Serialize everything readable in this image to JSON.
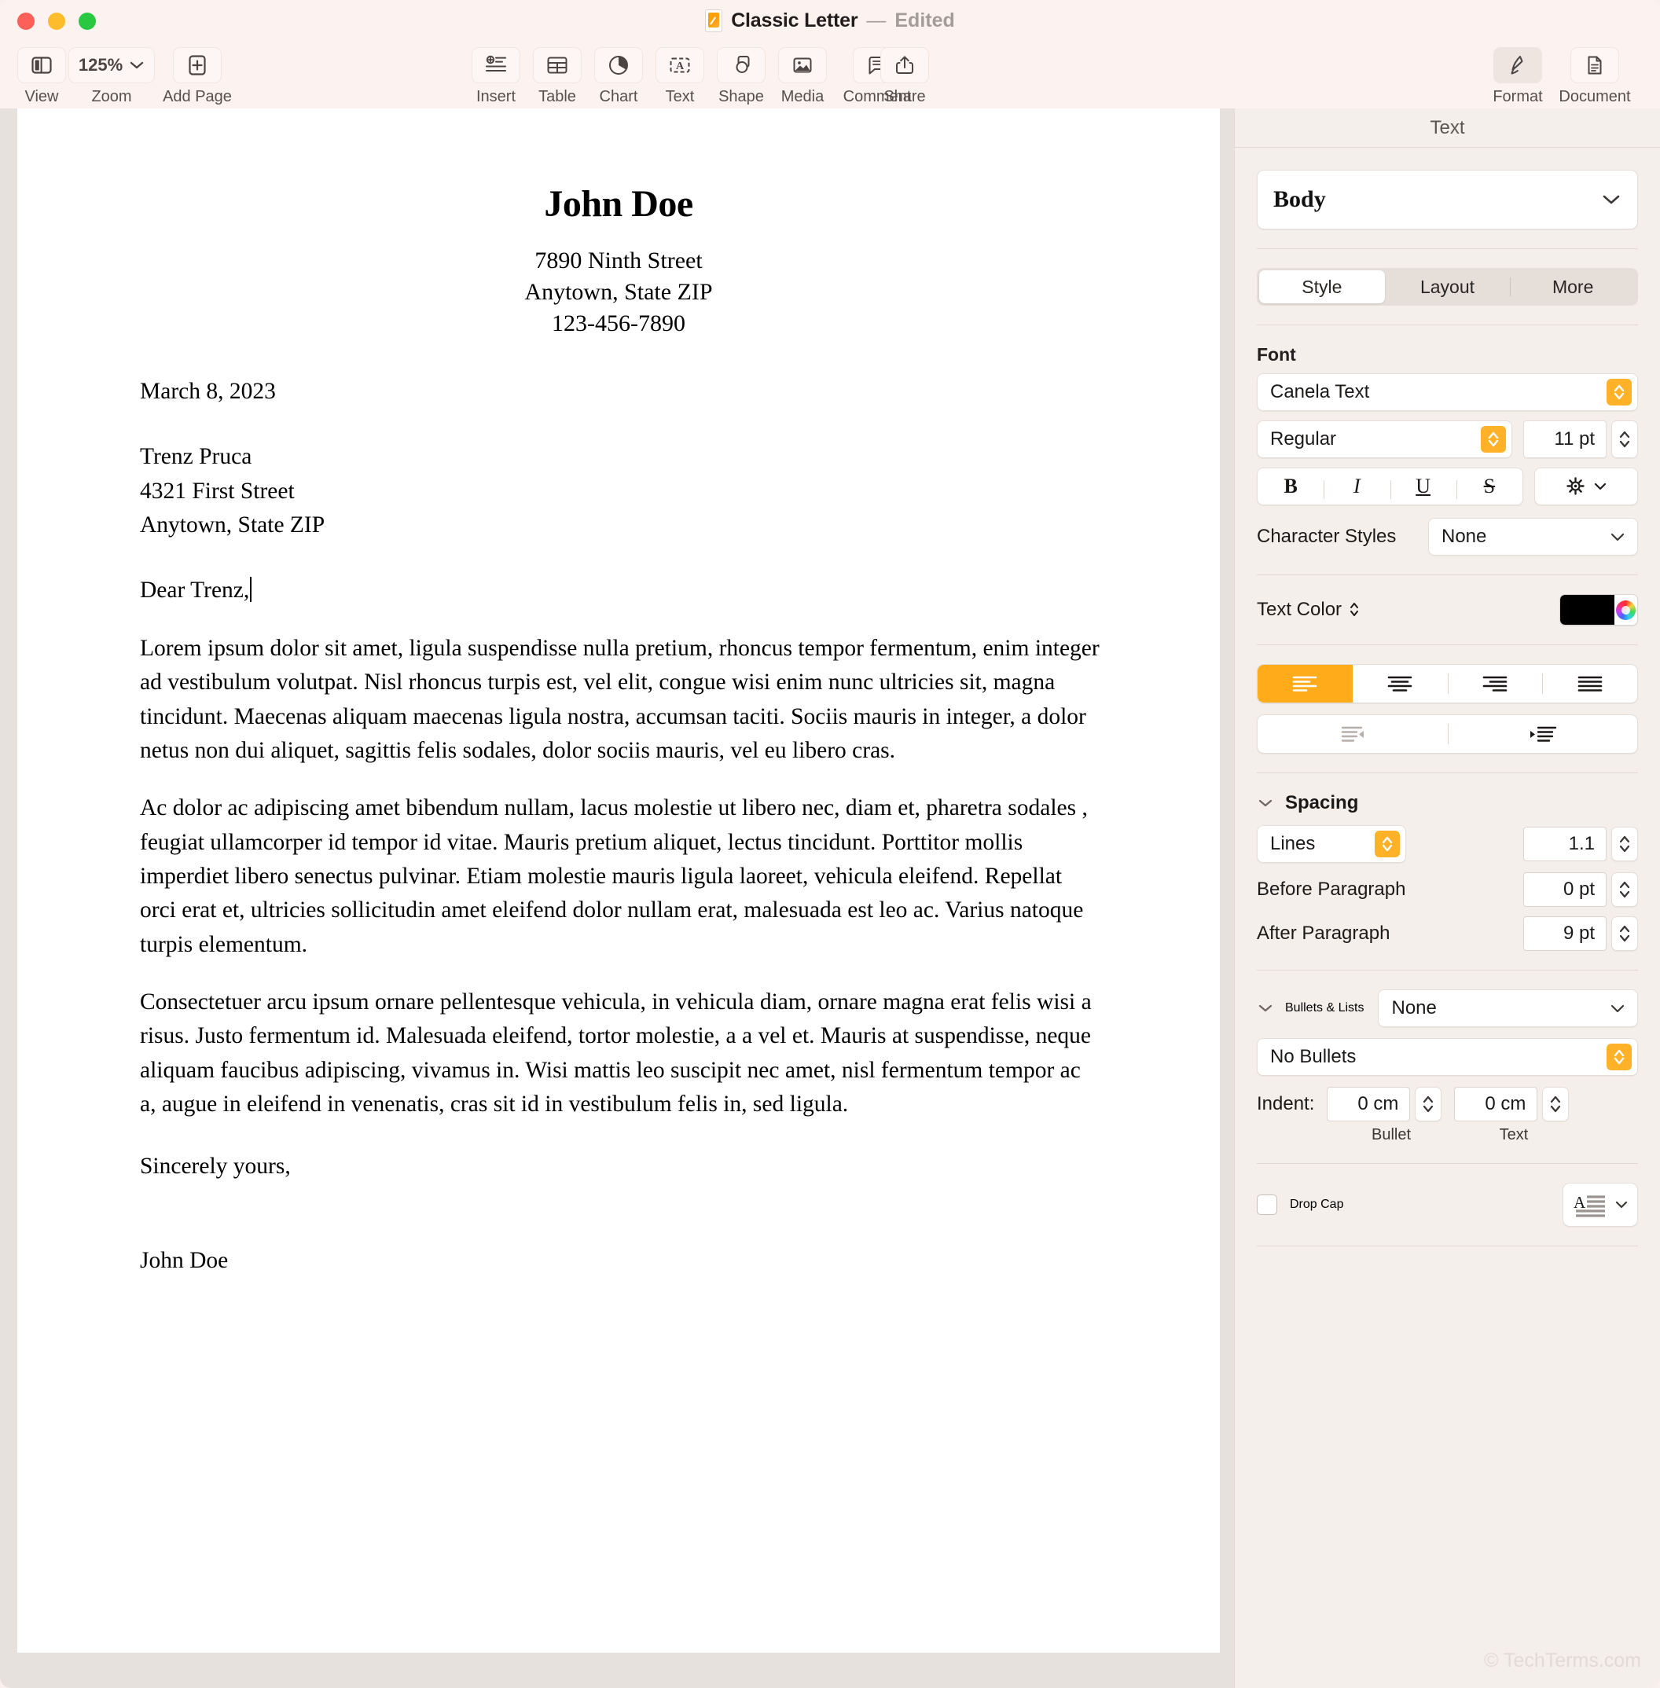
{
  "window": {
    "title": "Classic Letter",
    "separator": "—",
    "status": "Edited",
    "doc_icon": "pages-document-icon",
    "traffic_lights": [
      "close-button",
      "minimize-button",
      "maximize-button"
    ]
  },
  "toolbar": {
    "left": [
      {
        "label": "View",
        "icon": "sidebar-view-icon"
      },
      {
        "label": "Zoom",
        "value": "125%",
        "icon": "chevron-down-icon"
      },
      {
        "label": "Add Page",
        "icon": "add-page-icon"
      }
    ],
    "center": [
      {
        "label": "Insert",
        "icon": "insert-icon"
      },
      {
        "label": "Table",
        "icon": "table-icon"
      },
      {
        "label": "Chart",
        "icon": "chart-pie-icon"
      },
      {
        "label": "Text",
        "icon": "text-box-icon"
      },
      {
        "label": "Shape",
        "icon": "shape-icon"
      },
      {
        "label": "Media",
        "icon": "media-image-icon"
      },
      {
        "label": "Comment",
        "icon": "comment-bubble-icon"
      }
    ],
    "share": {
      "label": "Share",
      "icon": "share-icon"
    },
    "right": [
      {
        "label": "Format",
        "icon": "format-brush-icon",
        "active": true
      },
      {
        "label": "Document",
        "icon": "document-icon",
        "active": false
      }
    ]
  },
  "document": {
    "letterhead": {
      "name": "John Doe",
      "address_lines": [
        "7890 Ninth Street",
        "Anytown, State ZIP",
        "123-456-7890"
      ]
    },
    "date": "March 8, 2023",
    "recipient": [
      "Trenz Pruca",
      "4321 First Street",
      "Anytown, State ZIP"
    ],
    "salutation": "Dear Trenz,",
    "paragraphs": [
      "Lorem ipsum dolor sit amet, ligula suspendisse nulla pretium, rhoncus tempor fermentum, enim integer ad vestibulum volutpat. Nisl rhoncus turpis est, vel elit, congue wisi enim nunc ultricies sit, magna tincidunt. Maecenas aliquam maecenas ligula nostra, accumsan taciti. Sociis mauris in integer, a dolor netus non dui aliquet, sagittis felis sodales, dolor sociis mauris, vel eu libero cras.",
      "Ac dolor ac adipiscing amet bibendum nullam, lacus molestie ut libero nec, diam et, pharetra sodales , feugiat ullamcorper id tempor id vitae. Mauris pretium aliquet, lectus tincidunt. Porttitor mollis imperdiet libero senectus pulvinar. Etiam molestie mauris ligula laoreet, vehicula eleifend. Repellat orci erat et, ultricies sollicitudin amet eleifend dolor nullam erat, malesuada est leo ac. Varius natoque turpis elementum.",
      "Consectetuer arcu ipsum ornare pellentesque vehicula, in vehicula diam, ornare magna erat felis wisi a risus. Justo fermentum id. Malesuada eleifend, tortor molestie, a a vel et. Mauris at suspendisse, neque aliquam faucibus adipiscing, vivamus in. Wisi mattis leo suscipit nec amet, nisl fermentum tempor ac a, augue in eleifend in venenatis, cras sit id in vestibulum felis in, sed ligula."
    ],
    "closing": "Sincerely yours,",
    "signature": "John Doe"
  },
  "sidebar": {
    "header": "Text",
    "paragraph_style": "Body",
    "tabs": [
      {
        "label": "Style",
        "selected": true
      },
      {
        "label": "Layout",
        "selected": false
      },
      {
        "label": "More",
        "selected": false
      }
    ],
    "font": {
      "section_label": "Font",
      "family": "Canela Text",
      "weight": "Regular",
      "size": "11 pt",
      "buttons": [
        "B",
        "I",
        "U",
        "S"
      ],
      "gear_icon": "gear-options-icon",
      "character_styles_label": "Character Styles",
      "character_styles_value": "None"
    },
    "text_color": {
      "label": "Text Color",
      "swatch": "#000000",
      "wheel_icon": "color-wheel-icon"
    },
    "alignment": {
      "options": [
        "align-left",
        "align-center",
        "align-right",
        "align-justify"
      ],
      "selected": "align-left",
      "selected_color": "#ffab1a",
      "indent_options": [
        "decrease-indent",
        "increase-indent"
      ]
    },
    "spacing": {
      "title": "Spacing",
      "mode": "Lines",
      "mode_value": "1.1",
      "before_label": "Before Paragraph",
      "before_value": "0 pt",
      "after_label": "After Paragraph",
      "after_value": "9 pt"
    },
    "bullets": {
      "title": "Bullets & Lists",
      "list_style": "None",
      "bullet_type": "No Bullets",
      "indent_label": "Indent:",
      "bullet_indent": "0 cm",
      "text_indent": "0 cm",
      "bullet_caption": "Bullet",
      "text_caption": "Text"
    },
    "drop_cap": {
      "label": "Drop Cap",
      "checked": false,
      "preview_icon": "drop-cap-preview-icon"
    }
  },
  "watermark": "© TechTerms.com"
}
